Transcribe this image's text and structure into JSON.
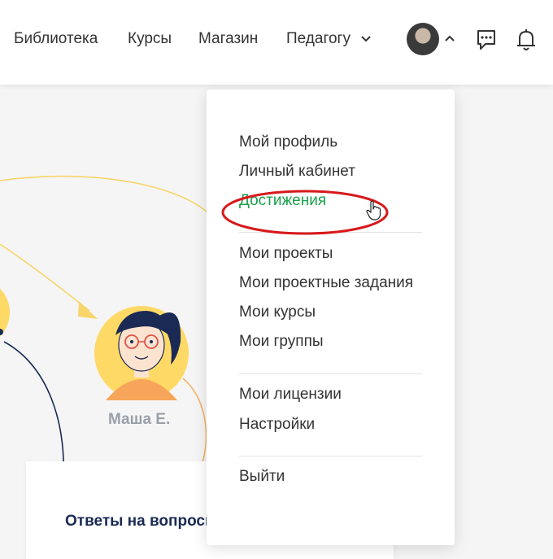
{
  "nav": {
    "items": [
      "Библиотека",
      "Курсы",
      "Магазин",
      "Педагогу"
    ]
  },
  "icons": {
    "nav_dropdown": "chevron-down-icon",
    "avatar_toggle": "chevron-up-icon",
    "messages": "chat-icon",
    "notifications": "bell-icon"
  },
  "dropdown": {
    "group1": [
      "Мой профиль",
      "Личный кабинет",
      "Достижения"
    ],
    "group2": [
      "Мои проекты",
      "Мои проектные задания",
      "Мои курсы",
      "Мои группы"
    ],
    "group3": [
      "Мои лицензии",
      "Настройки"
    ],
    "group4": [
      "Выйти"
    ]
  },
  "background": {
    "character_name": "Маша Е.",
    "card_title": "Ответы на вопросы"
  },
  "colors": {
    "active_item": "#19a14a",
    "highlight_ring": "#d7191c",
    "title_navy": "#1b2a55",
    "avatar_yellow": "#ffd966"
  }
}
